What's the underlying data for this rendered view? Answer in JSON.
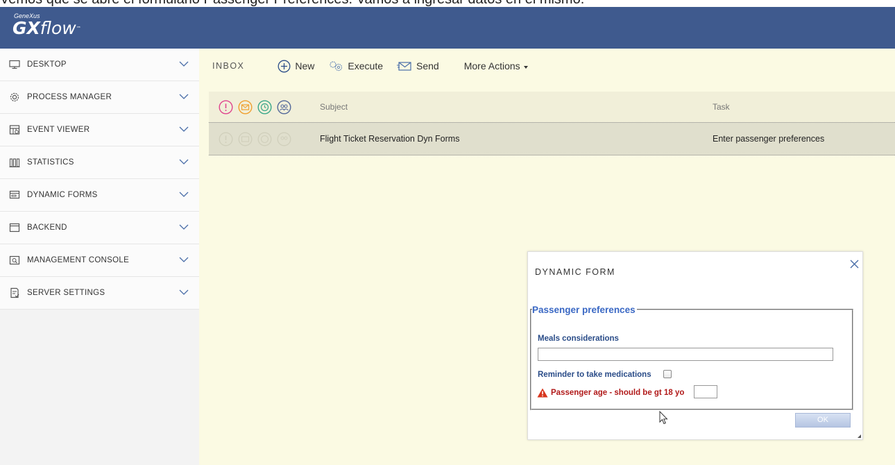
{
  "caption": "Vemos que se abre el formulario Passenger Preferences. Vamos a ingresar datos en el mismo.",
  "header": {
    "brand_small": "GeneXus",
    "brand_gx": "GX",
    "brand_flow": "flow",
    "brand_tm": "™",
    "background": "#3f5a8e"
  },
  "sidebar": {
    "items": [
      {
        "label": "DESKTOP",
        "icon": "monitor-icon"
      },
      {
        "label": "PROCESS MANAGER",
        "icon": "gear-icon"
      },
      {
        "label": "EVENT VIEWER",
        "icon": "calendar-icon"
      },
      {
        "label": "STATISTICS",
        "icon": "bar-chart-icon"
      },
      {
        "label": "DYNAMIC FORMS",
        "icon": "form-icon"
      },
      {
        "label": "BACKEND",
        "icon": "window-icon"
      },
      {
        "label": "MANAGEMENT CONSOLE",
        "icon": "console-icon"
      },
      {
        "label": "SERVER SETTINGS",
        "icon": "settings-doc-icon"
      }
    ]
  },
  "toolbar": {
    "inbox_label": "INBOX",
    "new_label": "New",
    "execute_label": "Execute",
    "send_label": "Send",
    "more_actions_label": "More Actions"
  },
  "grid": {
    "columns": {
      "subject": "Subject",
      "task": "Task"
    },
    "rows": [
      {
        "subject": "Flight Ticket Reservation Dyn Forms",
        "task": "Enter passenger preferences"
      }
    ]
  },
  "dialog": {
    "title": "DYNAMIC FORM",
    "legend": "Passenger preferences",
    "meals_label": "Meals considerations",
    "meals_value": "",
    "medications_label": "Reminder to take medications",
    "medications_checked": false,
    "age_label": "Passenger age - should be gt 18 yo",
    "age_value": "",
    "ok_label": "OK"
  },
  "colors": {
    "main_bg": "#fbfae3",
    "legend": "#3a68c4",
    "field_label": "#2a4c88",
    "error": "#b11a1a",
    "priority_icon": "#e0448e",
    "message_icon": "#f0a030",
    "clock_icon": "#3aa88a",
    "users_icon": "#556a9a"
  }
}
